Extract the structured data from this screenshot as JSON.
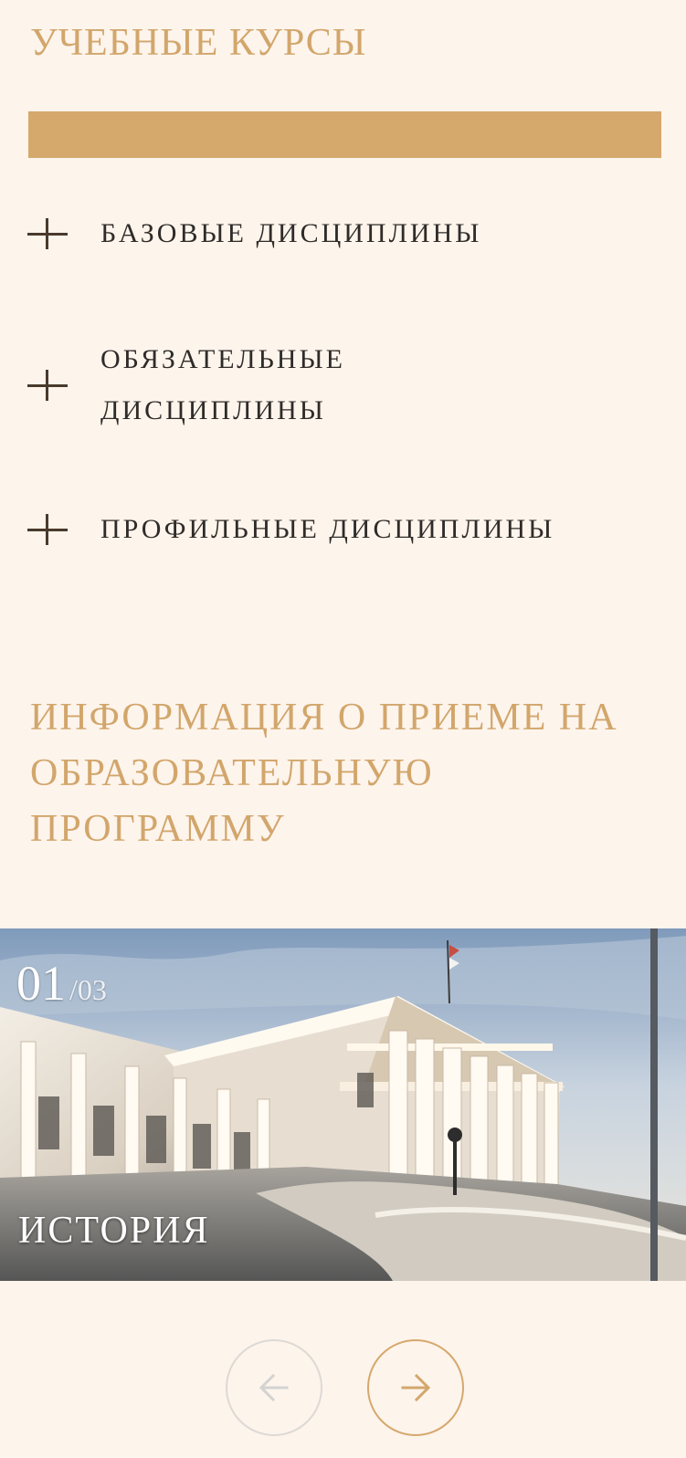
{
  "courses": {
    "title": "Учебные курсы",
    "items": [
      {
        "label": "Базовые дисциплины",
        "icon": "plus-icon"
      },
      {
        "label": "Обязательные дисциплины",
        "icon": "plus-icon"
      },
      {
        "label": "Профильные дисциплины",
        "icon": "plus-icon"
      }
    ]
  },
  "admission": {
    "title": "Информация о приеме на образовательную программу"
  },
  "slider": {
    "current": "01",
    "total": "/03",
    "caption": "История",
    "prev_icon": "arrow-left-icon",
    "next_icon": "arrow-right-icon"
  },
  "colors": {
    "accent": "#d2a66b",
    "background": "#fdf4ec",
    "text": "#2f2b28",
    "disabled": "#ddd9d5"
  }
}
